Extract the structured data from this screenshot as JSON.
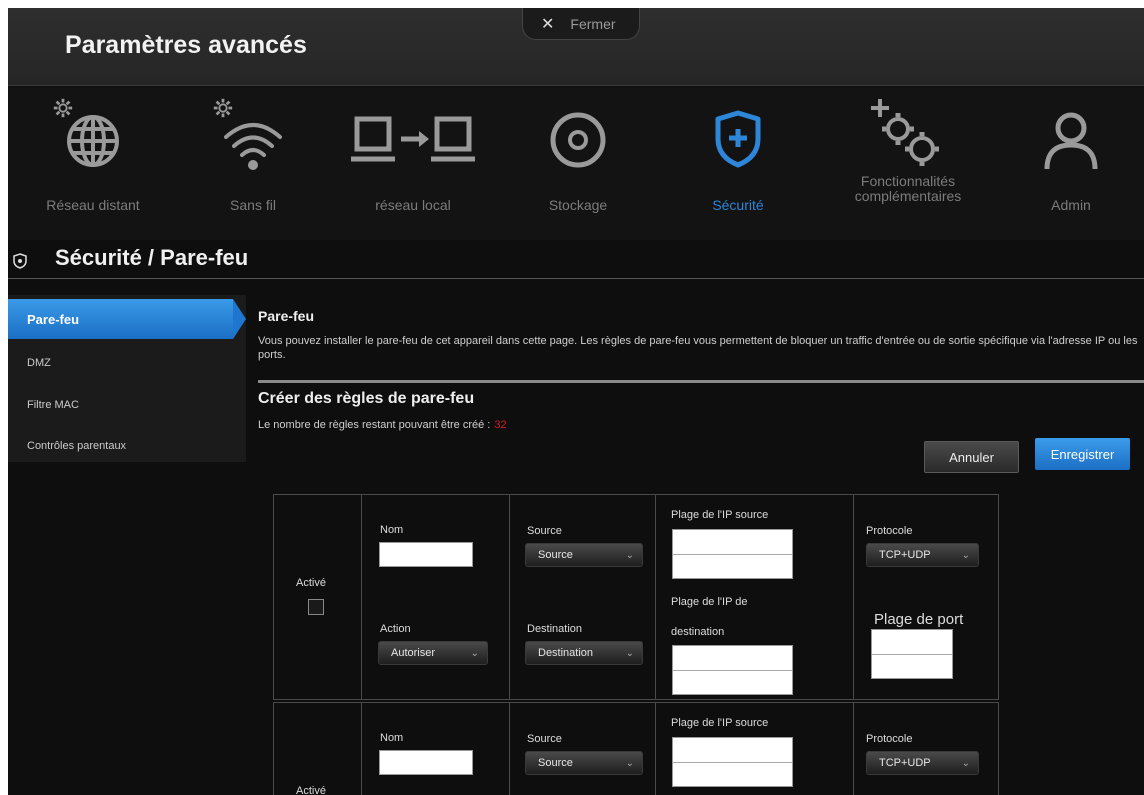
{
  "window": {
    "title": "Paramètres avancés",
    "close_label": "Fermer"
  },
  "nav": [
    {
      "label": "Réseau distant",
      "icon": "globe-icon"
    },
    {
      "label": "Sans fil",
      "icon": "wifi-icon"
    },
    {
      "label": "réseau local",
      "icon": "local-network-icon"
    },
    {
      "label": "Stockage",
      "icon": "storage-disc-icon"
    },
    {
      "label": "Sécurité",
      "icon": "shield-plus-icon",
      "active": true
    },
    {
      "label": "Fonctionnalités complémentaires",
      "label_line1": "Fonctionnalités",
      "label_line2": "complémentaires",
      "icon": "gears-plus-icon"
    },
    {
      "label": "Admin",
      "icon": "user-icon"
    }
  ],
  "section": {
    "title": "Sécurité / Pare-feu"
  },
  "sidebar": {
    "items": [
      {
        "label": "Pare-feu",
        "active": true
      },
      {
        "label": "DMZ"
      },
      {
        "label": "Filtre MAC"
      },
      {
        "label": "Contrôles parentaux"
      }
    ]
  },
  "content": {
    "heading": "Pare-feu",
    "description": "Vous pouvez installer le pare-feu de cet appareil dans cette page. Les règles de pare-feu vous permettent de bloquer un traffic d'entrée ou de sortie spécifique via l'adresse IP ou les ports.",
    "create_heading": "Créer des règles de pare-feu",
    "remaining_label": "Le nombre de règles restant pouvant être créé :",
    "remaining_count": "32",
    "cancel_label": "Annuler",
    "save_label": "Enregistrer"
  },
  "rule_form": {
    "active_label": "Activé",
    "name_label": "Nom",
    "action_label": "Action",
    "action_value": "Autoriser",
    "source_label": "Source",
    "source_value": "Source",
    "destination_label": "Destination",
    "destination_value": "Destination",
    "src_ip_label": "Plage de l'IP source",
    "dst_ip_label_line1": "Plage de l'IP de",
    "dst_ip_label_line2": "destination",
    "protocol_label": "Protocole",
    "protocol_value": "TCP+UDP",
    "port_label": "Plage de port"
  },
  "colors": {
    "accent": "#2d86d8",
    "background": "#0e0e0e",
    "count": "#d02020"
  }
}
